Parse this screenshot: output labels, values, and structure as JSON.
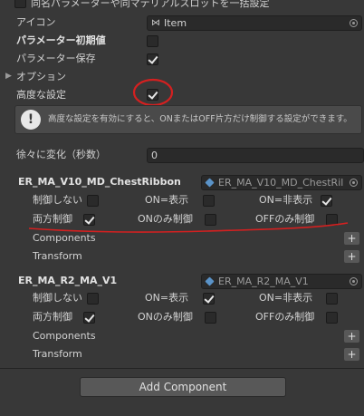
{
  "rows": {
    "top_label": "同名パラメーターや同マテリアルスロットを一括設定",
    "icon_label": "アイコン",
    "icon_value": "Item",
    "param_init": "パラメーター初期値",
    "param_save": "パラメーター保存",
    "options": "オプション",
    "advanced": "高度な設定"
  },
  "info": {
    "text": "高度な設定を有効にすると、ONまたはOFF片方だけ制御する設定ができます。"
  },
  "transition": {
    "label": "徐々に変化（秒数）",
    "value": "0"
  },
  "blocks": [
    {
      "name": "ER_MA_V10_MD_ChestRibbon",
      "ref": "ER_MA_V10_MD_ChestRil",
      "opt1": "制御しない",
      "opt2": "ON=表示",
      "opt3": "ON=非表示",
      "opt4": "両方制御",
      "opt5": "ONのみ制御",
      "opt6": "OFFのみ制御",
      "components": "Components",
      "transform": "Transform"
    },
    {
      "name": "ER_MA_R2_MA_V1",
      "ref": "ER_MA_R2_MA_V1",
      "opt1": "制御しない",
      "opt2": "ON=表示",
      "opt3": "ON=非表示",
      "opt4": "両方制御",
      "opt5": "ONのみ制御",
      "opt6": "OFFのみ制御",
      "components": "Components",
      "transform": "Transform"
    }
  ],
  "add_component": "Add Component",
  "plus_glyph": "+",
  "colors": {
    "background": "#383838",
    "annotation_red": "#d42020",
    "info_box": "#4a4a4a"
  }
}
